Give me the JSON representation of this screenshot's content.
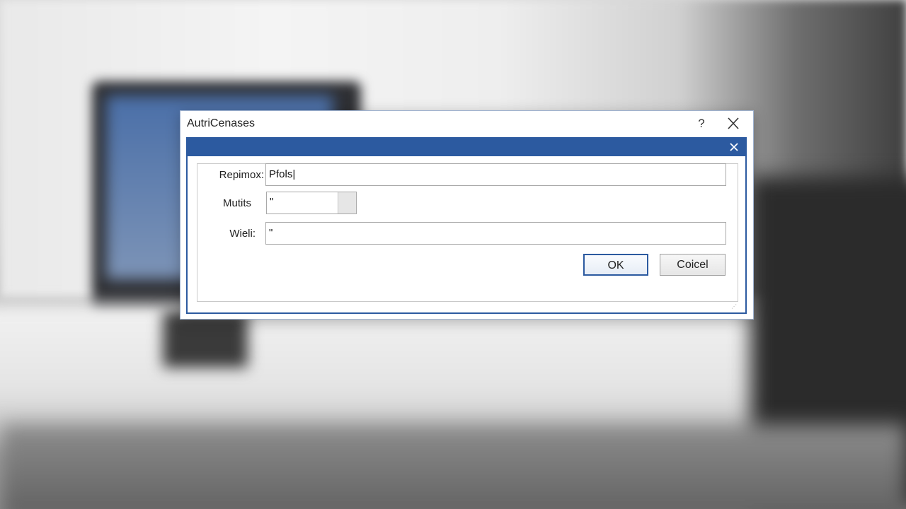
{
  "dialog": {
    "title": "AutriCenases",
    "help_glyph": "?",
    "grip_glyph": "⋰"
  },
  "form": {
    "fields": [
      {
        "label": "Repimox:",
        "value": "Pfols|"
      },
      {
        "label": "Mutits",
        "value": "\""
      },
      {
        "label": "Wieli:",
        "value": "\""
      }
    ]
  },
  "buttons": {
    "ok_label": "OK",
    "cancel_label": "Coicel"
  },
  "colors": {
    "accent": "#2c5aa0",
    "dialog_bg": "#ffffff",
    "border": "#a9a9a9"
  },
  "icons": {
    "help": "help-icon",
    "close": "close-icon",
    "inner_close": "close-icon",
    "spin": "spinner-icon"
  }
}
